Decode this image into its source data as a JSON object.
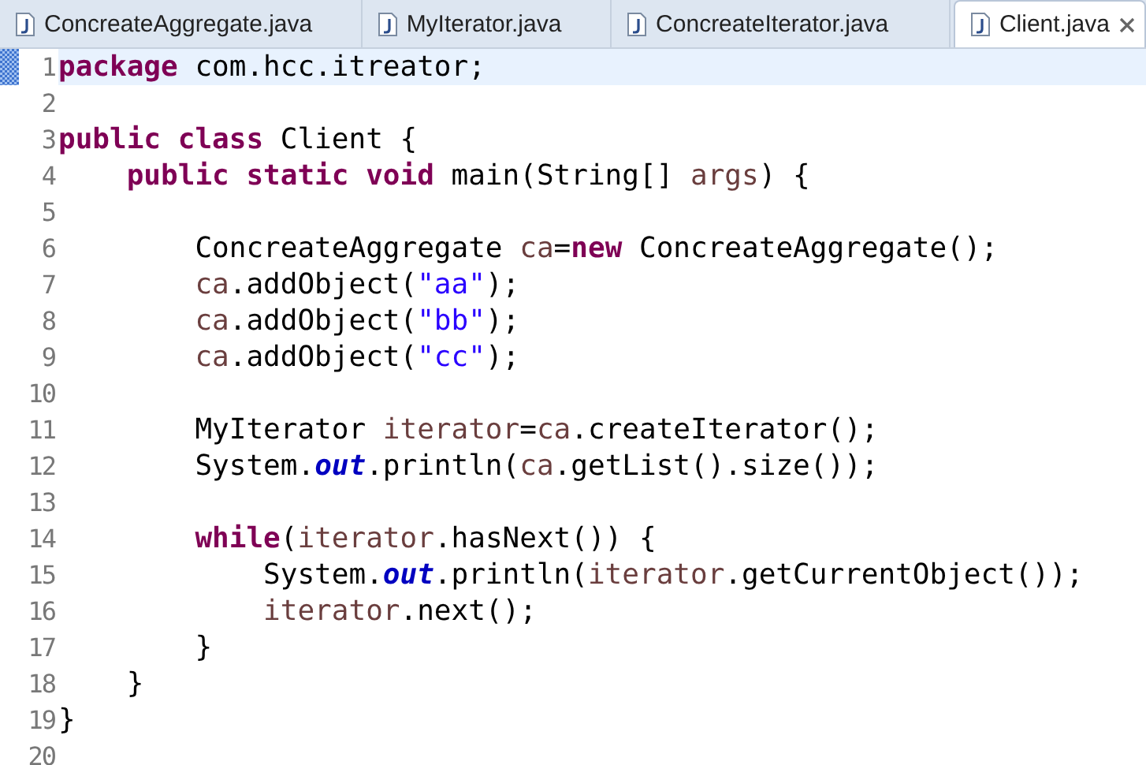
{
  "tabs": [
    {
      "label": "ConcreateAggregate.java",
      "selected": false
    },
    {
      "label": "MyIterator.java",
      "selected": false
    },
    {
      "label": "ConcreateIterator.java",
      "selected": false
    },
    {
      "label": "Client.java",
      "selected": true
    }
  ],
  "lines": [
    {
      "number": "1",
      "current": true,
      "tokens": [
        {
          "kind": "keyword",
          "text": "package"
        },
        {
          "kind": "plain",
          "text": " com.hcc.itreator;"
        }
      ]
    },
    {
      "number": "2"
    },
    {
      "number": "3",
      "tokens": [
        {
          "kind": "keyword",
          "text": "public class"
        },
        {
          "kind": "plain",
          "text": " Client {"
        }
      ]
    },
    {
      "number": "4",
      "tokens": [
        {
          "kind": "keyword",
          "text": "    public static void"
        },
        {
          "kind": "plain",
          "text": " main(String[] "
        },
        {
          "kind": "local",
          "text": "args"
        },
        {
          "kind": "plain",
          "text": ") {"
        }
      ]
    },
    {
      "number": "5"
    },
    {
      "number": "6",
      "tokens": [
        {
          "kind": "plain",
          "text": "        ConcreateAggregate "
        },
        {
          "kind": "local",
          "text": "ca"
        },
        {
          "kind": "plain",
          "text": "="
        },
        {
          "kind": "keyword",
          "text": "new"
        },
        {
          "kind": "plain",
          "text": " ConcreateAggregate();"
        }
      ]
    },
    {
      "number": "7",
      "tokens": [
        {
          "kind": "local",
          "text": "        ca"
        },
        {
          "kind": "plain",
          "text": ".addObject("
        },
        {
          "kind": "string",
          "text": "\"aa\""
        },
        {
          "kind": "plain",
          "text": ");"
        }
      ]
    },
    {
      "number": "8",
      "tokens": [
        {
          "kind": "local",
          "text": "        ca"
        },
        {
          "kind": "plain",
          "text": ".addObject("
        },
        {
          "kind": "string",
          "text": "\"bb\""
        },
        {
          "kind": "plain",
          "text": ");"
        }
      ]
    },
    {
      "number": "9",
      "tokens": [
        {
          "kind": "local",
          "text": "        ca"
        },
        {
          "kind": "plain",
          "text": ".addObject("
        },
        {
          "kind": "string",
          "text": "\"cc\""
        },
        {
          "kind": "plain",
          "text": ");"
        }
      ]
    },
    {
      "number": "10"
    },
    {
      "number": "11",
      "tokens": [
        {
          "kind": "plain",
          "text": "        MyIterator "
        },
        {
          "kind": "local",
          "text": "iterator"
        },
        {
          "kind": "plain",
          "text": "="
        },
        {
          "kind": "local",
          "text": "ca"
        },
        {
          "kind": "plain",
          "text": ".createIterator();"
        }
      ]
    },
    {
      "number": "12",
      "tokens": [
        {
          "kind": "plain",
          "text": "        System."
        },
        {
          "kind": "field",
          "text": "out"
        },
        {
          "kind": "plain",
          "text": ".println("
        },
        {
          "kind": "local",
          "text": "ca"
        },
        {
          "kind": "plain",
          "text": ".getList().size());"
        }
      ]
    },
    {
      "number": "13"
    },
    {
      "number": "14",
      "tokens": [
        {
          "kind": "keyword",
          "text": "        while"
        },
        {
          "kind": "plain",
          "text": "("
        },
        {
          "kind": "local",
          "text": "iterator"
        },
        {
          "kind": "plain",
          "text": ".hasNext()) {"
        }
      ]
    },
    {
      "number": "15",
      "tokens": [
        {
          "kind": "plain",
          "text": "            System."
        },
        {
          "kind": "field",
          "text": "out"
        },
        {
          "kind": "plain",
          "text": ".println("
        },
        {
          "kind": "local",
          "text": "iterator"
        },
        {
          "kind": "plain",
          "text": ".getCurrentObject());"
        }
      ]
    },
    {
      "number": "16",
      "tokens": [
        {
          "kind": "local",
          "text": "            iterator"
        },
        {
          "kind": "plain",
          "text": ".next();"
        }
      ]
    },
    {
      "number": "17",
      "tokens": [
        {
          "kind": "plain",
          "text": "        }"
        }
      ]
    },
    {
      "number": "18",
      "tokens": [
        {
          "kind": "plain",
          "text": "    }"
        }
      ]
    },
    {
      "number": "19",
      "tokens": [
        {
          "kind": "plain",
          "text": "}"
        }
      ]
    },
    {
      "number": "20"
    }
  ]
}
